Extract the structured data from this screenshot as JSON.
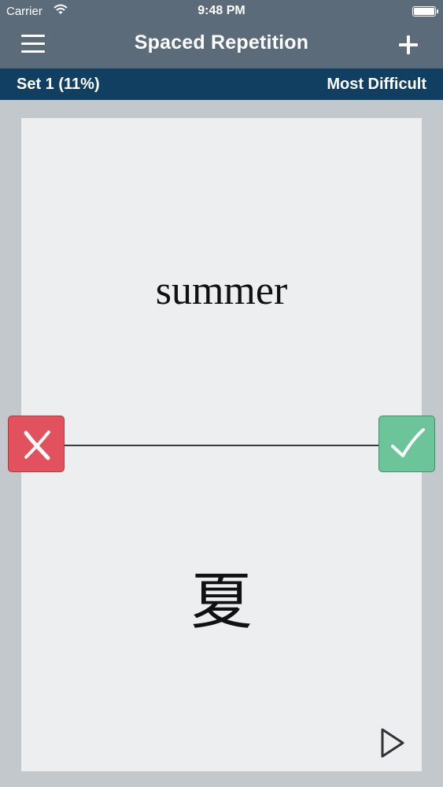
{
  "status_bar": {
    "carrier": "Carrier",
    "time": "9:48 PM",
    "wifi_icon": "wifi-icon",
    "battery_icon": "battery-icon"
  },
  "nav_bar": {
    "title": "Spaced Repetition",
    "menu_icon": "hamburger-menu-icon",
    "add_icon": "plus-icon"
  },
  "sub_bar": {
    "set_label": "Set 1 (11%)",
    "mode_label": "Most Difficult"
  },
  "card": {
    "front_text": "summer",
    "back_text": "夏"
  },
  "actions": {
    "wrong_icon": "x-mark-icon",
    "right_icon": "checkmark-icon",
    "play_icon": "play-icon"
  },
  "colors": {
    "nav_background": "#5b6b79",
    "sub_bar_background": "#103f61",
    "page_background": "#c3c8cc",
    "card_background": "#eceef0",
    "wrong_button": "#e2525e",
    "right_button": "#6cc49b"
  }
}
